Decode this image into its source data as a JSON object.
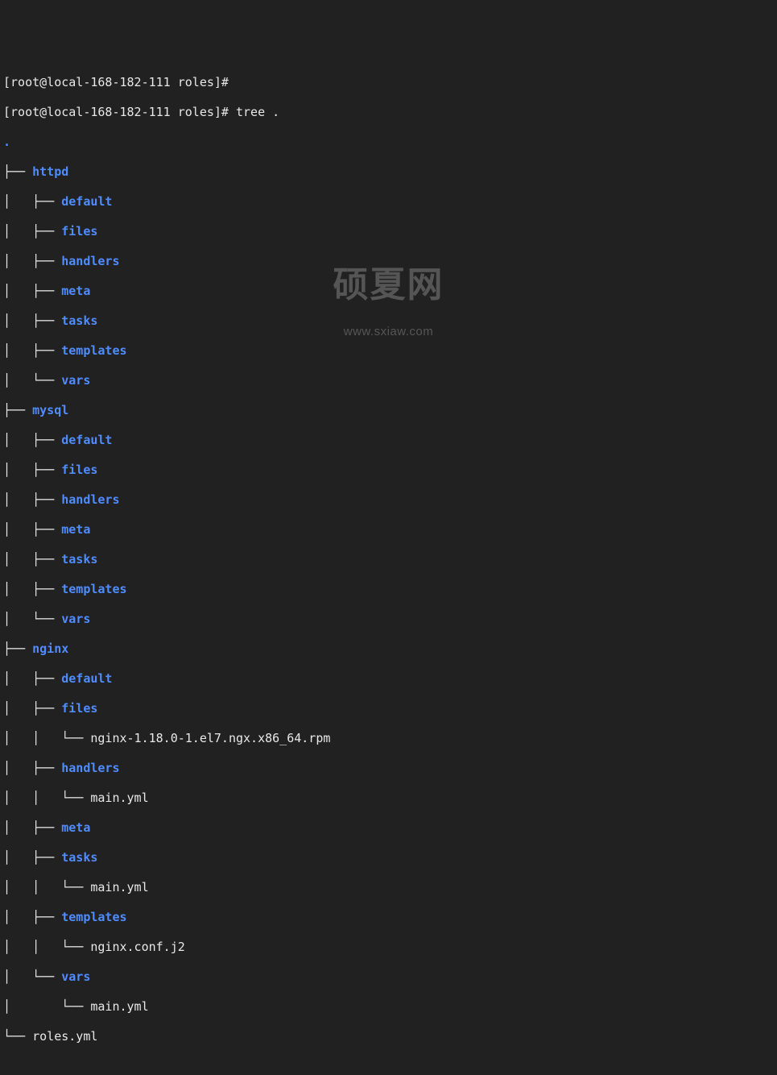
{
  "prompt": {
    "prev_line": "[root@local-168-182-111 roles]#",
    "user_host_path": "[root@local-168-182-111 roles]#",
    "command": "tree ."
  },
  "root_dot": ".",
  "tree": {
    "httpd": {
      "name": "httpd",
      "children": {
        "default": {
          "prefix": "│   ├── ",
          "name": "default",
          "type": "dir"
        },
        "files": {
          "prefix": "│   ├── ",
          "name": "files",
          "type": "dir"
        },
        "handlers": {
          "prefix": "│   ├── ",
          "name": "handlers",
          "type": "dir"
        },
        "meta": {
          "prefix": "│   ├── ",
          "name": "meta",
          "type": "dir"
        },
        "tasks": {
          "prefix": "│   ├── ",
          "name": "tasks",
          "type": "dir"
        },
        "templates": {
          "prefix": "│   ├── ",
          "name": "templates",
          "type": "dir"
        },
        "vars": {
          "prefix": "│   └── ",
          "name": "vars",
          "type": "dir"
        }
      }
    },
    "mysql": {
      "name": "mysql",
      "children": {
        "default": {
          "prefix": "│   ├── ",
          "name": "default",
          "type": "dir"
        },
        "files": {
          "prefix": "│   ├── ",
          "name": "files",
          "type": "dir"
        },
        "handlers": {
          "prefix": "│   ├── ",
          "name": "handlers",
          "type": "dir"
        },
        "meta": {
          "prefix": "│   ├── ",
          "name": "meta",
          "type": "dir"
        },
        "tasks": {
          "prefix": "│   ├── ",
          "name": "tasks",
          "type": "dir"
        },
        "templates": {
          "prefix": "│   ├── ",
          "name": "templates",
          "type": "dir"
        },
        "vars": {
          "prefix": "│   └── ",
          "name": "vars",
          "type": "dir"
        }
      }
    },
    "nginx": {
      "name": "nginx",
      "children": {
        "default": {
          "prefix": "│   ├── ",
          "name": "default",
          "type": "dir"
        },
        "files": {
          "prefix": "│   ├── ",
          "name": "files",
          "type": "dir",
          "child": {
            "prefix": "│   │   └── ",
            "name": "nginx-1.18.0-1.el7.ngx.x86_64.rpm",
            "type": "file"
          }
        },
        "handlers": {
          "prefix": "│   ├── ",
          "name": "handlers",
          "type": "dir",
          "child": {
            "prefix": "│   │   └── ",
            "name": "main.yml",
            "type": "file"
          }
        },
        "meta": {
          "prefix": "│   ├── ",
          "name": "meta",
          "type": "dir"
        },
        "tasks": {
          "prefix": "│   ├── ",
          "name": "tasks",
          "type": "dir",
          "child": {
            "prefix": "│   │   └── ",
            "name": "main.yml",
            "type": "file"
          }
        },
        "templates": {
          "prefix": "│   ├── ",
          "name": "templates",
          "type": "dir",
          "child": {
            "prefix": "│   │   └── ",
            "name": "nginx.conf.j2",
            "type": "file"
          }
        },
        "vars": {
          "prefix": "│   └── ",
          "name": "vars",
          "type": "dir",
          "child": {
            "prefix": "│       └── ",
            "name": "main.yml",
            "type": "file"
          }
        }
      }
    },
    "roles_yml": {
      "prefix": "└── ",
      "name": "roles.yml",
      "type": "file"
    }
  },
  "watermark": {
    "main": "硕夏网",
    "sub": "www.sxiaw.com"
  }
}
